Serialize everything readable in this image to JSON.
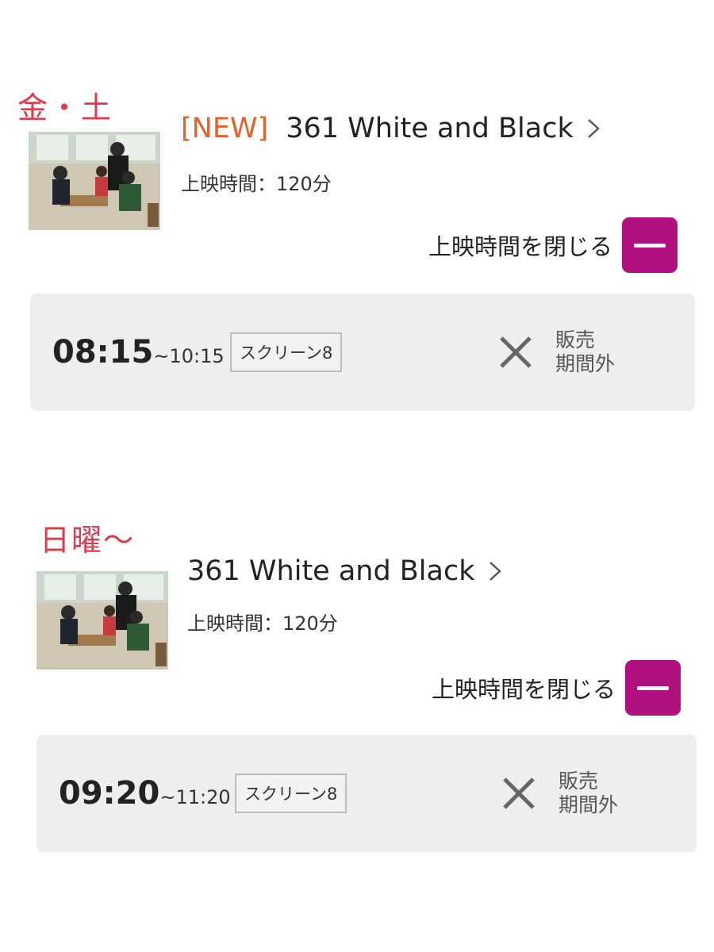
{
  "sections": [
    {
      "day_label": "金・土",
      "new_badge": "[NEW]",
      "movie_title": "361 White and Black",
      "runtime": "上映時間：120分",
      "toggle_label": "上映時間を閉じる",
      "showtime": {
        "start": "08:15",
        "end": "~10:15",
        "screen": "スクリーン8",
        "status": "販売\n期間外"
      }
    },
    {
      "day_label": "日曜〜",
      "movie_title": "361 White and Black",
      "runtime": "上映時間：120分",
      "toggle_label": "上映時間を閉じる",
      "showtime": {
        "start": "09:20",
        "end": "~11:20",
        "screen": "スクリーン8",
        "status": "販売\n期間外"
      }
    }
  ],
  "colors": {
    "day_label": "#e03a4a",
    "new_badge": "#e4612a",
    "toggle_button": "#b0117f",
    "card_bg": "#eeeeee"
  },
  "icons": [
    "chevron-right-icon",
    "minus-icon",
    "close-icon"
  ]
}
